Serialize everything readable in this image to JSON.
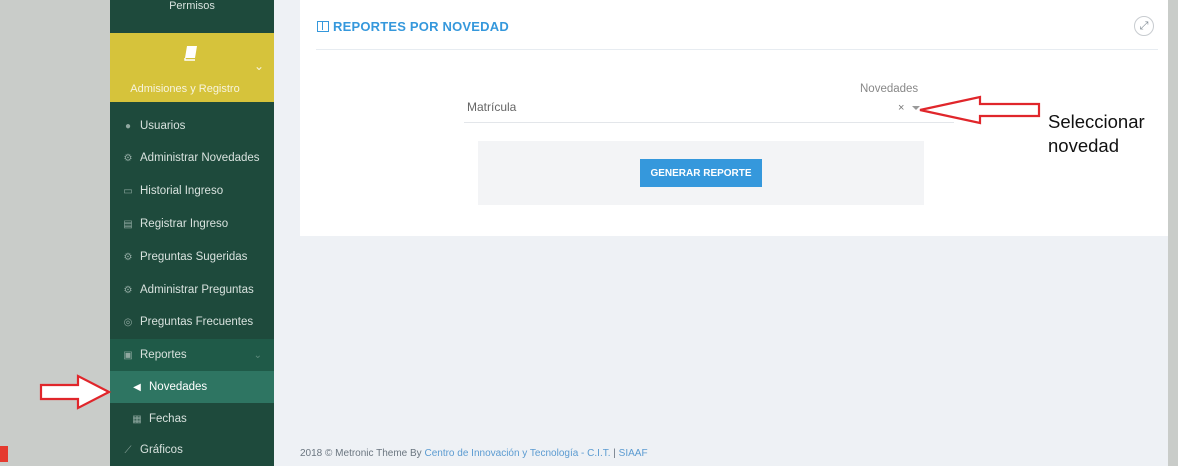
{
  "sidebar": {
    "top_label": "Permisos",
    "active_group": {
      "label": "Admisiones y Registro",
      "icon": "book-icon"
    },
    "items": [
      {
        "label": "Usuarios",
        "icon": "user-icon"
      },
      {
        "label": "Administrar Novedades",
        "icon": "cogs-icon"
      },
      {
        "label": "Historial Ingreso",
        "icon": "monitor-icon"
      },
      {
        "label": "Registrar Ingreso",
        "icon": "id-card-icon"
      },
      {
        "label": "Preguntas Sugeridas",
        "icon": "cogs-icon"
      },
      {
        "label": "Administrar Preguntas",
        "icon": "cogs-icon"
      },
      {
        "label": "Preguntas Frecuentes",
        "icon": "lifebuoy-icon"
      },
      {
        "label": "Reportes",
        "icon": "pdf-icon"
      },
      {
        "label": "Novedades",
        "icon": "bullhorn-icon"
      },
      {
        "label": "Fechas",
        "icon": "calendar-icon"
      },
      {
        "label": "Gráficos",
        "icon": "line-chart-icon"
      }
    ]
  },
  "portlet": {
    "title": "REPORTES POR NOVEDAD",
    "field_label": "Novedades",
    "select_value": "Matrícula",
    "clear_symbol": "×",
    "button_label": "GENERAR REPORTE"
  },
  "footer": {
    "prefix": "2018 © Metronic Theme By",
    "link": "Centro de Innovación y Tecnología - C.I.T.",
    "separator": "|",
    "suffix": "SIAAF"
  },
  "annotation": {
    "line1": "Seleccionar",
    "line2": "novedad",
    "arrow_color": "#e0262b"
  },
  "colors": {
    "sidebar": "#1e4a3c",
    "active": "#d6c33b",
    "accent": "#3598dc"
  }
}
